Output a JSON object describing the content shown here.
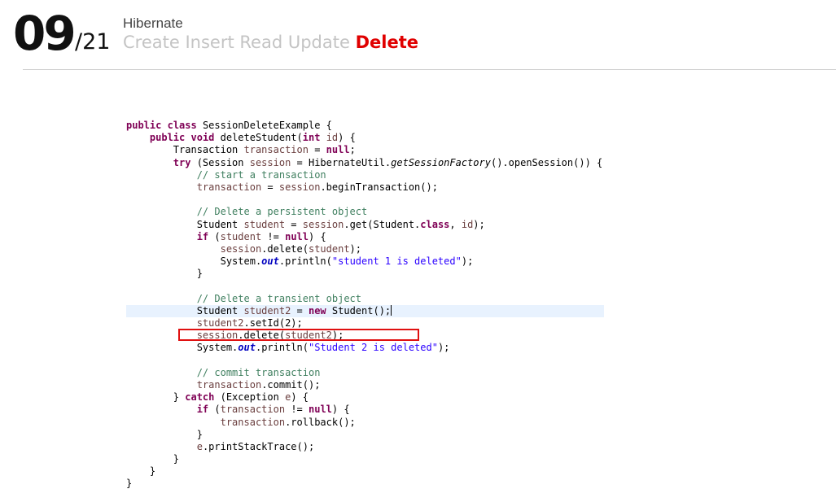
{
  "header": {
    "page_number": "09",
    "page_total": "/21",
    "subtitle": "Hibernate",
    "crud": {
      "create": "Create",
      "insert": "Insert",
      "read": "Read",
      "update": "Update",
      "delete": "Delete"
    }
  },
  "colors": {
    "accent": "#e00000",
    "inactive": "#c4c4c4",
    "keyword": "#7f0055",
    "comment": "#3f7f5f",
    "string": "#2a00ff",
    "field": "#0000c0",
    "current_line": "#e8f2fe",
    "highlight_box": "#e01010"
  },
  "code": {
    "language": "java",
    "highlighted_line": "session.delete(student2);",
    "lines": [
      "public class SessionDeleteExample {",
      "    public void deleteStudent(int id) {",
      "        Transaction transaction = null;",
      "        try (Session session = HibernateUtil.getSessionFactory().openSession()) {",
      "            // start a transaction",
      "            transaction = session.beginTransaction();",
      "",
      "            // Delete a persistent object",
      "            Student student = session.get(Student.class, id);",
      "            if (student != null) {",
      "                session.delete(student);",
      "                System.out.println(\"student 1 is deleted\");",
      "            }",
      "",
      "            // Delete a transient object",
      "            Student student2 = new Student();",
      "            student2.setId(2);",
      "            session.delete(student2);",
      "            System.out.println(\"Student 2 is deleted\");",
      "",
      "            // commit transaction",
      "            transaction.commit();",
      "        } catch (Exception e) {",
      "            if (transaction != null) {",
      "                transaction.rollback();",
      "            }",
      "            e.printStackTrace();",
      "        }",
      "    }",
      "}"
    ]
  }
}
